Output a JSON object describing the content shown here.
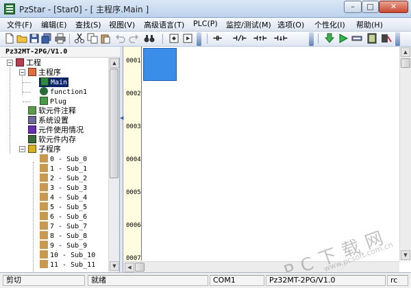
{
  "window": {
    "title": "PzStar - [Star0] - [ 主程序.Main ]",
    "min_label": "–",
    "max_label": "□",
    "close_label": "✕"
  },
  "menu": [
    "文件(F)",
    "编辑(E)",
    "查找(S)",
    "视图(V)",
    "高级语言(T)",
    "PLC(P)",
    "监控/测试(M)",
    "选项(O)",
    "个性化(I)",
    "帮助(H)"
  ],
  "toolbar": {
    "ladder_symbols": [
      "⊣⊢",
      "⊣/⊢",
      "⊣↑⊢",
      "⊣↓⊢"
    ]
  },
  "project": {
    "plc_model": "Pz32MT-2PG/V1.0",
    "root": "工程",
    "main_program": "主程序",
    "main_children": [
      "Main",
      "function1",
      "Plug"
    ],
    "nodes": [
      "软元件注释",
      "系统设置",
      "元件使用情况",
      "软元件内存"
    ],
    "subroutines_label": "子程序",
    "subroutines": [
      "0 - Sub_0",
      "1 - Sub_1",
      "2 - Sub_2",
      "3 - Sub_3",
      "4 - Sub_4",
      "5 - Sub_5",
      "6 - Sub_6",
      "7 - Sub_7",
      "8 - Sub_8",
      "9 - Sub_9",
      "10 - Sub_10",
      "11 - Sub_11"
    ]
  },
  "editor": {
    "line_numbers": [
      "0001",
      "0002",
      "0003",
      "0004",
      "0005",
      "0006",
      "0007"
    ]
  },
  "watermark": {
    "text": "PC下载网",
    "url": "www.pcsoft.com.cn"
  },
  "status": {
    "cut": "剪切",
    "ready": "就绪",
    "port": "COM1",
    "model": "Pz32MT-2PG/V1.0",
    "mode": "rc"
  },
  "colors": {
    "cursor": "#3a8de8",
    "gutter": "#fffde0"
  }
}
